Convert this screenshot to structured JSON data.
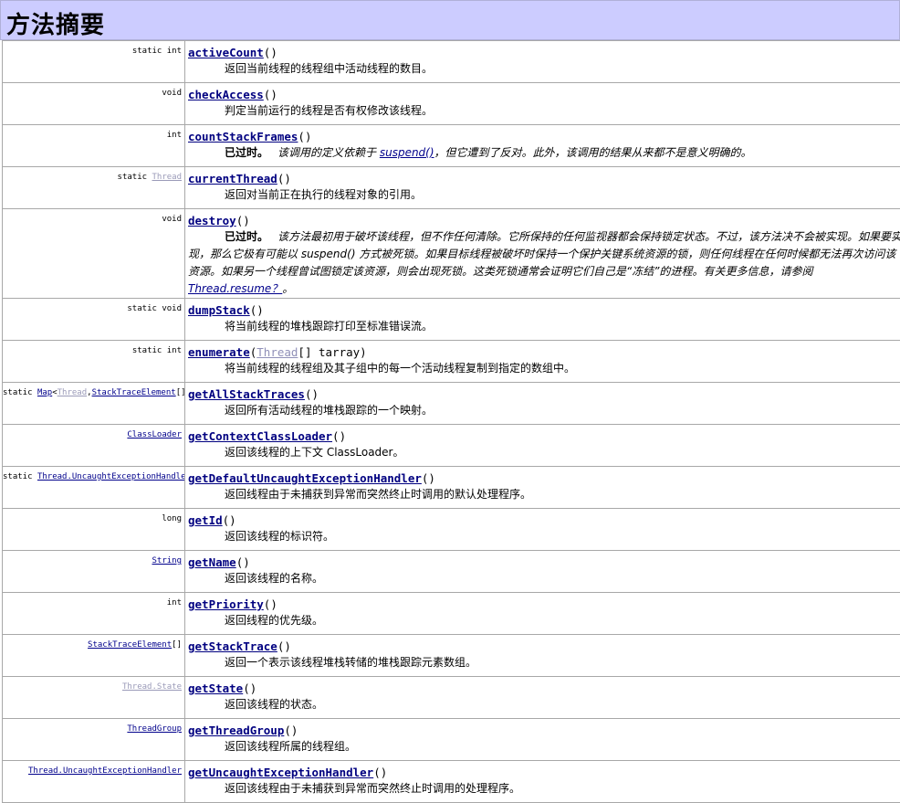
{
  "title": "方法摘要",
  "rows": [
    {
      "mod": "static int",
      "name": "activeCount",
      "desc": "返回当前线程的线程组中活动线程的数目。"
    },
    {
      "mod": "void",
      "name": "checkAccess",
      "desc": "判定当前运行的线程是否有权修改该线程。"
    },
    {
      "mod": "int",
      "name": "countStackFrames",
      "deprecated": "已过时。",
      "dep_pre": "该调用的定义依赖于 ",
      "dep_link": "suspend()",
      "dep_post": "，但它遭到了反对。此外，该调用的结果从来都不是意义明确的。"
    },
    {
      "mod_pre": "static ",
      "mod_link": "Thread",
      "name": "currentThread",
      "desc": "返回对当前正在执行的线程对象的引用。"
    },
    {
      "mod": "void",
      "name": "destroy",
      "deprecated": "已过时。",
      "dep_pre": "该方法最初用于破坏该线程，但不作任何清除。它所保持的任何监视器都会保持锁定状态。不过，该方法决不会被实现。如果要实现，那么它极有可能以 suspend() 方式被死锁。如果目标线程被破坏时保持一个保护关键系统资源的锁，则任何线程在任何时候都无法再次访问该资源。如果另一个线程曾试图锁定该资源，则会出现死锁。这类死锁通常会证明它们自己是“冻结”的进程。有关更多信息，请参阅",
      "dep_link": "Thread.resume？",
      "dep_post": "。"
    },
    {
      "mod": "static void",
      "name": "dumpStack",
      "desc": "将当前线程的堆栈跟踪打印至标准错误流。"
    },
    {
      "mod": "static int",
      "name": "enumerate",
      "param_type": "Thread",
      "param_rest": "[] tarray",
      "desc": "将当前线程的线程组及其子组中的每一个活动线程复制到指定的数组中。"
    },
    {
      "mod_pre": "static ",
      "mod_link": "Map",
      "mod_lt": "<",
      "mod_link2": "Thread",
      "mod_comma": ",",
      "mod_link3": "StackTraceElement",
      "mod_post": "[]>",
      "name": "getAllStackTraces",
      "desc": "返回所有活动线程的堆栈跟踪的一个映射。"
    },
    {
      "mod_link": "ClassLoader",
      "name": "getContextClassLoader",
      "desc": "返回该线程的上下文 ClassLoader。"
    },
    {
      "mod_pre": "static ",
      "mod_link": "Thread.UncaughtExceptionHandler",
      "name": "getDefaultUncaughtExceptionHandler",
      "desc": "返回线程由于未捕获到异常而突然终止时调用的默认处理程序。"
    },
    {
      "mod": "long",
      "name": "getId",
      "desc": "返回该线程的标识符。"
    },
    {
      "mod_link": "String",
      "name": "getName",
      "desc": "返回该线程的名称。"
    },
    {
      "mod": "int",
      "name": "getPriority",
      "desc": "返回线程的优先级。"
    },
    {
      "mod_link": "StackTraceElement",
      "mod_post": "[]",
      "name": "getStackTrace",
      "desc": "返回一个表示该线程堆栈转储的堆栈跟踪元素数组。"
    },
    {
      "mod_link": "Thread.State",
      "name": "getState",
      "desc": "返回该线程的状态。"
    },
    {
      "mod_link": "ThreadGroup",
      "name": "getThreadGroup",
      "desc": "返回该线程所属的线程组。"
    },
    {
      "mod_link": "Thread.UncaughtExceptionHandler",
      "name": "getUncaughtExceptionHandler",
      "desc": "返回该线程由于未捕获到异常而突然终止时调用的处理程序。"
    }
  ],
  "paren_open": "(",
  "paren_close": ")"
}
